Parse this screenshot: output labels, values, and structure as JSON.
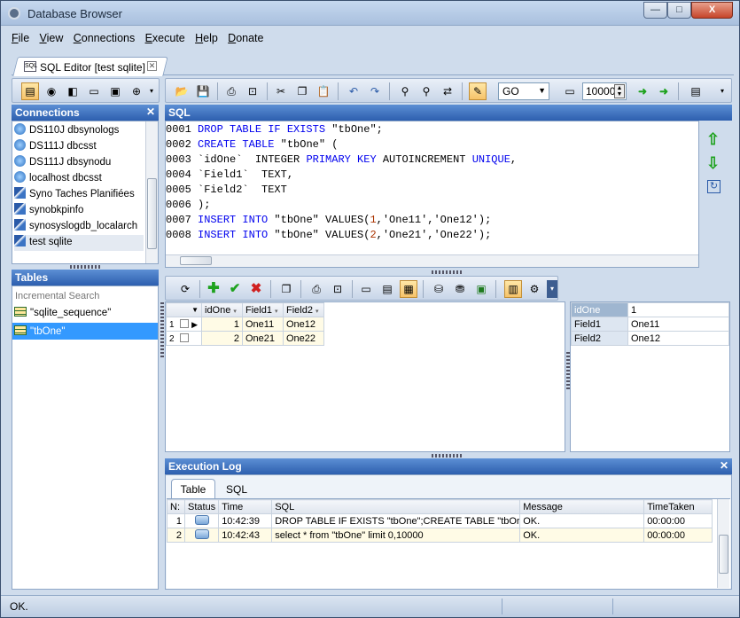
{
  "window": {
    "title": "Database Browser",
    "minimize": "—",
    "maximize": "□",
    "close": "X"
  },
  "menu": [
    "File",
    "View",
    "Connections",
    "Execute",
    "Help",
    "Donate"
  ],
  "doc_tab": {
    "label": "SQL Editor [test sqlite]"
  },
  "toolbar": {
    "exec_mode": "GO",
    "row_limit": "10000"
  },
  "connections": {
    "title": "Connections",
    "items": [
      {
        "label": "DS110J dbsynologs",
        "icon": "globe-icon"
      },
      {
        "label": "DS111J dbcsst",
        "icon": "globe-icon"
      },
      {
        "label": "DS111J dbsynodu",
        "icon": "globe-icon"
      },
      {
        "label": "localhost dbcsst",
        "icon": "globe-icon"
      },
      {
        "label": "Syno Taches Planifiées",
        "icon": "feather-icon"
      },
      {
        "label": "synobkpinfo",
        "icon": "feather-icon"
      },
      {
        "label": "synosyslogdb_localarch",
        "icon": "feather-icon"
      },
      {
        "label": "test sqlite",
        "icon": "feather-icon"
      }
    ]
  },
  "tables": {
    "title": "Tables",
    "search_placeholder": "Incremental Search",
    "items": [
      "\"sqlite_sequence\"",
      "\"tbOne\""
    ]
  },
  "sql": {
    "title": "SQL",
    "lines": [
      {
        "n": "0001",
        "text": "DROP TABLE IF EXISTS \"tbOne\";"
      },
      {
        "n": "0002",
        "text": "CREATE TABLE \"tbOne\" ("
      },
      {
        "n": "0003",
        "text": "`idOne`  INTEGER PRIMARY KEY AUTOINCREMENT UNIQUE,"
      },
      {
        "n": "0004",
        "text": "`Field1`  TEXT,"
      },
      {
        "n": "0005",
        "text": "`Field2`  TEXT"
      },
      {
        "n": "0006",
        "text": ");"
      },
      {
        "n": "0007",
        "text": "INSERT INTO \"tbOne\" VALUES(1,'One11','One12');"
      },
      {
        "n": "0008",
        "text": "INSERT INTO \"tbOne\" VALUES(2,'One21','One22');"
      }
    ]
  },
  "results": {
    "columns": [
      "idOne",
      "Field1",
      "Field2"
    ],
    "rows": [
      {
        "n": "1",
        "idOne": "1",
        "Field1": "One11",
        "Field2": "One12"
      },
      {
        "n": "2",
        "idOne": "2",
        "Field1": "One21",
        "Field2": "One22"
      }
    ]
  },
  "record": [
    {
      "field": "idOne",
      "value": "1"
    },
    {
      "field": "Field1",
      "value": "One11"
    },
    {
      "field": "Field2",
      "value": "One12"
    }
  ],
  "log": {
    "title": "Execution Log",
    "tabs": [
      "Table",
      "SQL"
    ],
    "columns": [
      "N:",
      "Status",
      "Time",
      "SQL",
      "Message",
      "TimeTaken"
    ],
    "rows": [
      {
        "n": "1",
        "time": "10:42:39",
        "sql": "DROP TABLE IF EXISTS \"tbOne\";CREATE TABLE \"tbOr",
        "message": "OK.",
        "taken": "00:00:00"
      },
      {
        "n": "2",
        "time": "10:42:43",
        "sql": "select * from \"tbOne\" limit 0,10000",
        "message": "OK.",
        "taken": "00:00:00"
      }
    ]
  },
  "status": {
    "text": "OK."
  }
}
